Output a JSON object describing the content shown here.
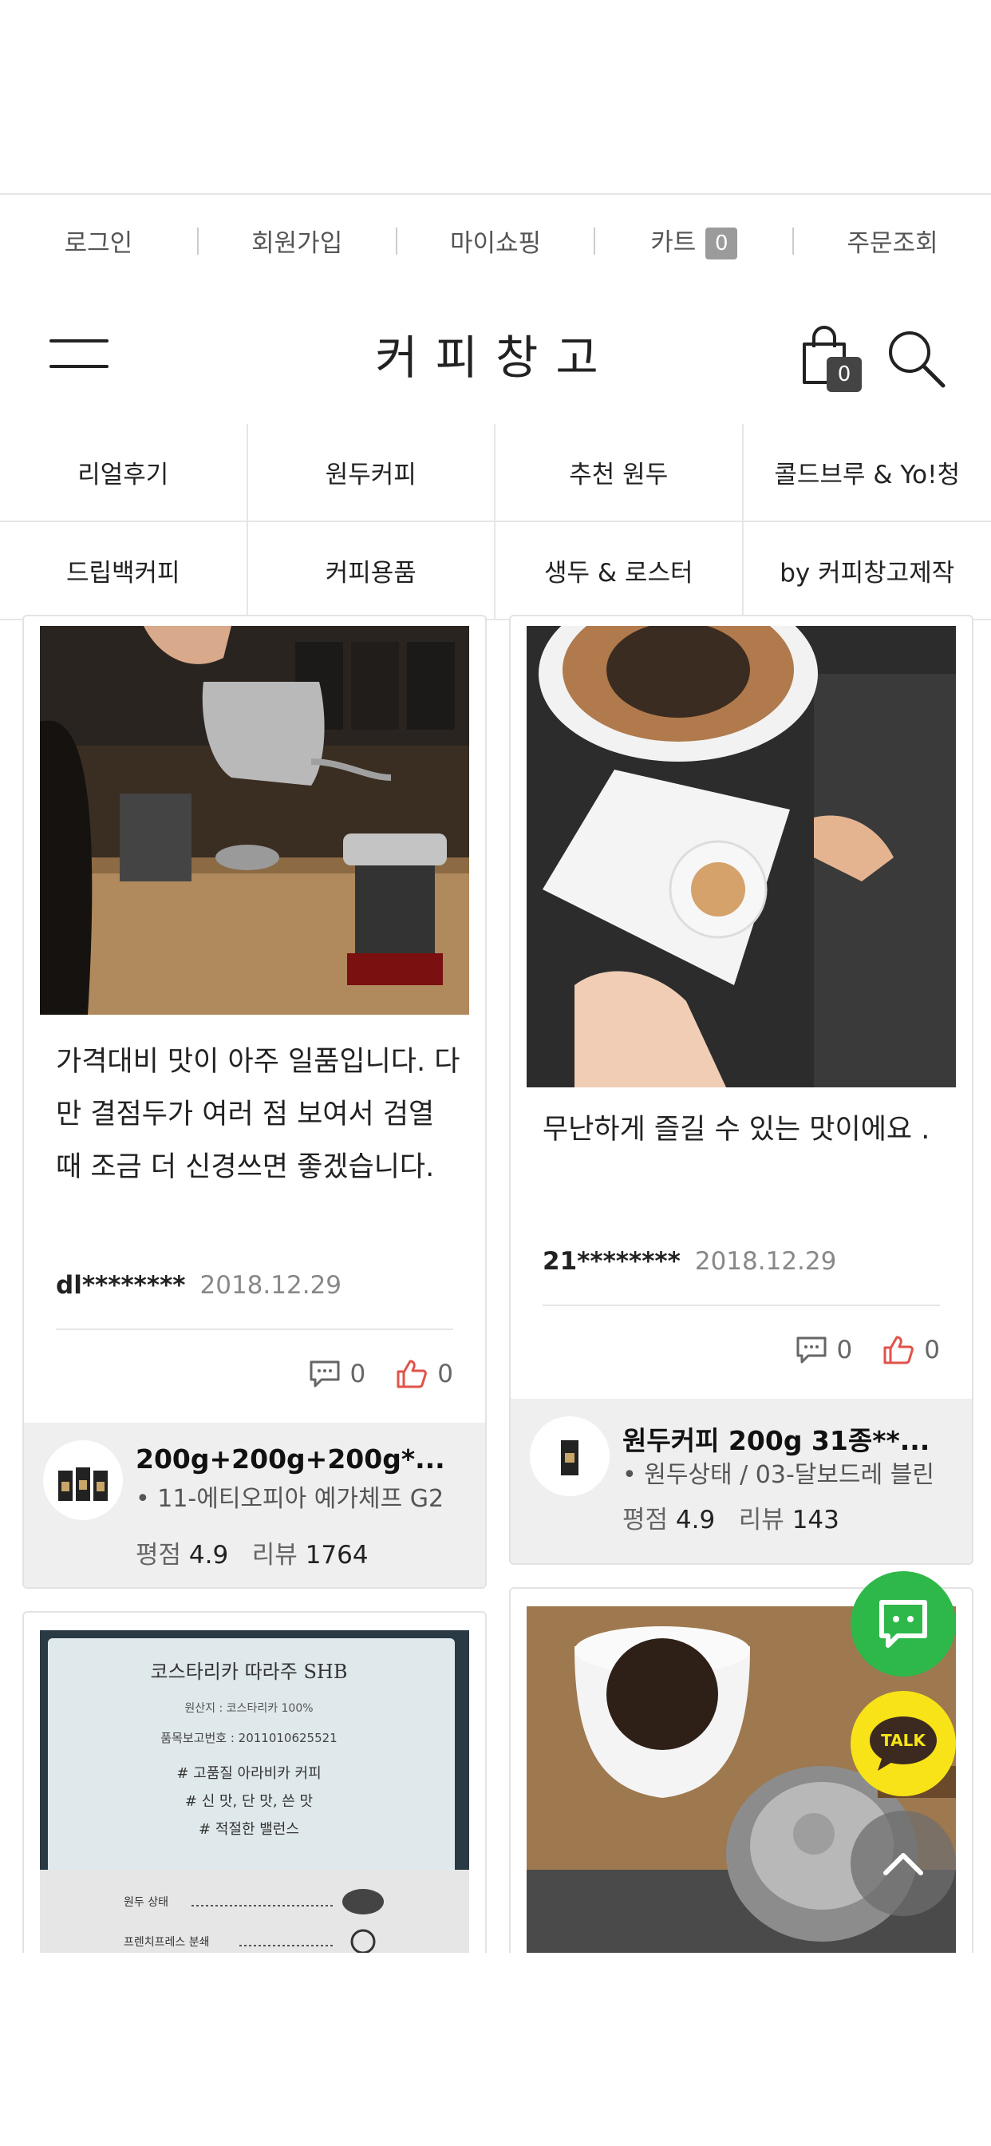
{
  "topbar": {
    "login": "로그인",
    "join": "회원가입",
    "myshop": "마이쇼핑",
    "cart": "카트",
    "cart_count": "0",
    "order": "주문조회"
  },
  "header": {
    "brand": "커피창고",
    "bag_count": "0"
  },
  "categories": [
    "리얼후기",
    "원두커피",
    "추천 원두",
    "콜드브루 & Yo!청",
    "드립백커피",
    "커피용품",
    "생두 & 로스터",
    "by 커피창고제작"
  ],
  "reviews": [
    {
      "text": "가격대비 맛이 아주 일품입니다. 다만 결점두가 여러 점 보여서 검열 때 조금 더 신경쓰면 좋겠습니다.",
      "user": "dl********",
      "date": "2018.12.29",
      "comments": "0",
      "likes": "0",
      "product_name": "200g+200g+200g*...",
      "product_option": "• 11-에티오피아 예가체프 G2",
      "rating_label": "평점",
      "rating": "4.9",
      "review_label": "리뷰",
      "review_count": "1764"
    },
    {
      "text": "무난하게 즐길 수 있는 맛이에요 .",
      "user": "21********",
      "date": "2018.12.29",
      "comments": "0",
      "likes": "0",
      "product_name": "원두커피 200g 31종**...",
      "product_option": "• 원두상태 / 03-달보드레 블린",
      "rating_label": "평점",
      "rating": "4.9",
      "review_label": "리뷰",
      "review_count": "143"
    }
  ],
  "photo_labels": {
    "bag_title": "코스타리카 따라주 SHB",
    "bag_origin": "원산지 : 코스타리카 100%",
    "bag_report": "품목보고번호 : 2011010625521",
    "bag_tag1": "# 고품질 아라비카 커피",
    "bag_tag2": "# 신 맛, 단 맛, 쓴 맛",
    "bag_tag3": "# 적절한 밸런스",
    "bag_row1": "원두 상태",
    "bag_row2": "프렌치프레스 분쇄"
  },
  "floating": {
    "talk_label": "TALK"
  },
  "colors": {
    "chat_green": "#2fb84a",
    "talk_yellow": "#f7e317",
    "like_red": "#e0534a"
  }
}
